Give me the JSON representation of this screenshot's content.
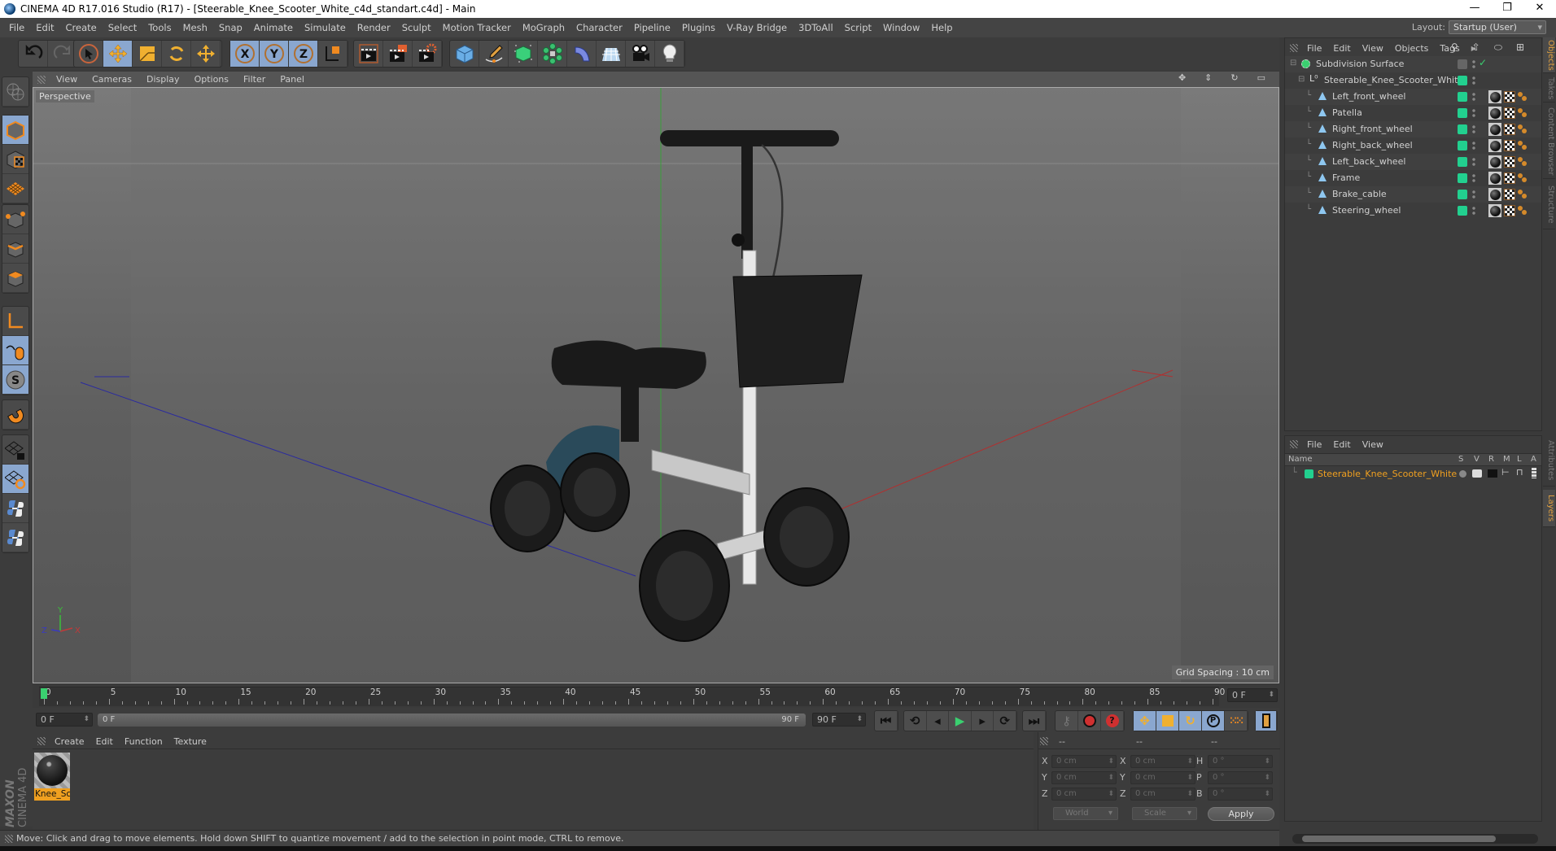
{
  "window": {
    "title": "CINEMA 4D R17.016 Studio (R17) - [Steerable_Knee_Scooter_White_c4d_standart.c4d] - Main",
    "minimize": "—",
    "maximize": "❐",
    "close": "✕"
  },
  "menu": [
    "File",
    "Edit",
    "Create",
    "Select",
    "Tools",
    "Mesh",
    "Snap",
    "Animate",
    "Simulate",
    "Render",
    "Sculpt",
    "Motion Tracker",
    "MoGraph",
    "Character",
    "Pipeline",
    "Plugins",
    "V-Ray Bridge",
    "3DToAll",
    "Script",
    "Window",
    "Help"
  ],
  "layout": {
    "label": "Layout:",
    "value": "Startup (User)"
  },
  "toolbar": {
    "undo": "undo-icon",
    "redo": "redo-icon",
    "tools": [
      "live-selection",
      "move",
      "scale",
      "rotate",
      "last-tool"
    ],
    "axes": [
      "X",
      "Y",
      "Z"
    ],
    "coord_system": "world-coordinate-icon",
    "render": [
      "render-view",
      "render-picture-viewer",
      "render-settings"
    ],
    "objects": [
      "cube",
      "pen",
      "subdivision-surface",
      "cloner",
      "bend-deformer",
      "floor",
      "camera",
      "light"
    ]
  },
  "left_toolbar": [
    "make-editable",
    "model-mode",
    "texture-mode",
    "workplane-mode",
    "points-mode",
    "edges-mode",
    "polygons-mode",
    "axis-mode",
    "tweak-mode",
    "solo-mode",
    "snap",
    "lock-workplane",
    "planar-workplane",
    "python",
    "python-2"
  ],
  "viewport": {
    "menu": [
      "View",
      "Cameras",
      "Display",
      "Options",
      "Filter",
      "Panel"
    ],
    "camera_label": "Perspective",
    "grid_spacing": "Grid Spacing : 10 cm",
    "axis_labels": {
      "x": "X",
      "y": "Y",
      "z": "Z"
    }
  },
  "timeline": {
    "ticks": [
      "0",
      "5",
      "10",
      "15",
      "20",
      "25",
      "30",
      "35",
      "40",
      "45",
      "50",
      "55",
      "60",
      "65",
      "70",
      "75",
      "80",
      "85",
      "90"
    ],
    "current_frame": "0 F",
    "start_field": "0 F",
    "slider_start": "0 F",
    "slider_end": "90 F",
    "end_field": "90 F",
    "min_frame": 0,
    "max_frame": 90
  },
  "playback": {
    "buttons": [
      "go-to-start",
      "previous-key",
      "previous-frame",
      "play",
      "next-frame",
      "next-key",
      "go-to-end"
    ],
    "glyphs": [
      "⏮",
      "⟲",
      "◂",
      "▶",
      "▸",
      "⟳",
      "⏭"
    ],
    "record": [
      "motion-record",
      "autokey",
      "keyframe-selection"
    ],
    "key_types": [
      "position",
      "scale",
      "rotation",
      "parameter",
      "point-level",
      "timeline"
    ]
  },
  "material_panel": {
    "menu": [
      "Create",
      "Edit",
      "Function",
      "Texture"
    ],
    "materials": [
      {
        "name": "Knee_Sc"
      }
    ]
  },
  "coordinates": {
    "headers": [
      "--",
      "--",
      "--"
    ],
    "rows": [
      {
        "a": "X",
        "av": "0 cm",
        "b": "X",
        "bv": "0 cm",
        "c": "H",
        "cv": "0 °"
      },
      {
        "a": "Y",
        "av": "0 cm",
        "b": "Y",
        "bv": "0 cm",
        "c": "P",
        "cv": "0 °"
      },
      {
        "a": "Z",
        "av": "0 cm",
        "b": "Z",
        "bv": "0 cm",
        "c": "B",
        "cv": "0 °"
      }
    ],
    "mode": "World",
    "size_mode": "Scale",
    "apply": "Apply"
  },
  "status": "Move: Click and drag to move elements. Hold down SHIFT to quantize movement / add to the selection in point mode, CTRL to remove.",
  "brand": {
    "maxon": "MAXON",
    "product": "CINEMA 4D"
  },
  "object_manager": {
    "menu": [
      "File",
      "Edit",
      "View",
      "Objects",
      "Tags"
    ],
    "objects": [
      {
        "name": "Subdivision Surface",
        "type": "subdivision",
        "level": 0
      },
      {
        "name": "Steerable_Knee_Scooter_White",
        "type": "null",
        "level": 1
      },
      {
        "name": "Left_front_wheel",
        "type": "polygon",
        "level": 2
      },
      {
        "name": "Patella",
        "type": "polygon",
        "level": 2
      },
      {
        "name": "Right_front_wheel",
        "type": "polygon",
        "level": 2
      },
      {
        "name": "Right_back_wheel",
        "type": "polygon",
        "level": 2
      },
      {
        "name": "Left_back_wheel",
        "type": "polygon",
        "level": 2
      },
      {
        "name": "Frame",
        "type": "polygon",
        "level": 2
      },
      {
        "name": "Brake_cable",
        "type": "polygon",
        "level": 2
      },
      {
        "name": "Steering_wheel",
        "type": "polygon",
        "level": 2
      }
    ]
  },
  "layers_panel": {
    "menu": [
      "File",
      "Edit",
      "View"
    ],
    "columns": [
      "Name",
      "S",
      "V",
      "R",
      "M",
      "L",
      "A"
    ],
    "layers": [
      {
        "name": "Steerable_Knee_Scooter_White",
        "color": "#22d08f"
      }
    ]
  },
  "right_tabs": [
    "Objects",
    "Takes",
    "Content Browser",
    "Structure",
    "Attributes",
    "Layers"
  ],
  "colors": {
    "accent": "#e0a040",
    "selection": "#8aa7cf",
    "layer": "#22d08f",
    "layer_text": "#f0a020"
  }
}
